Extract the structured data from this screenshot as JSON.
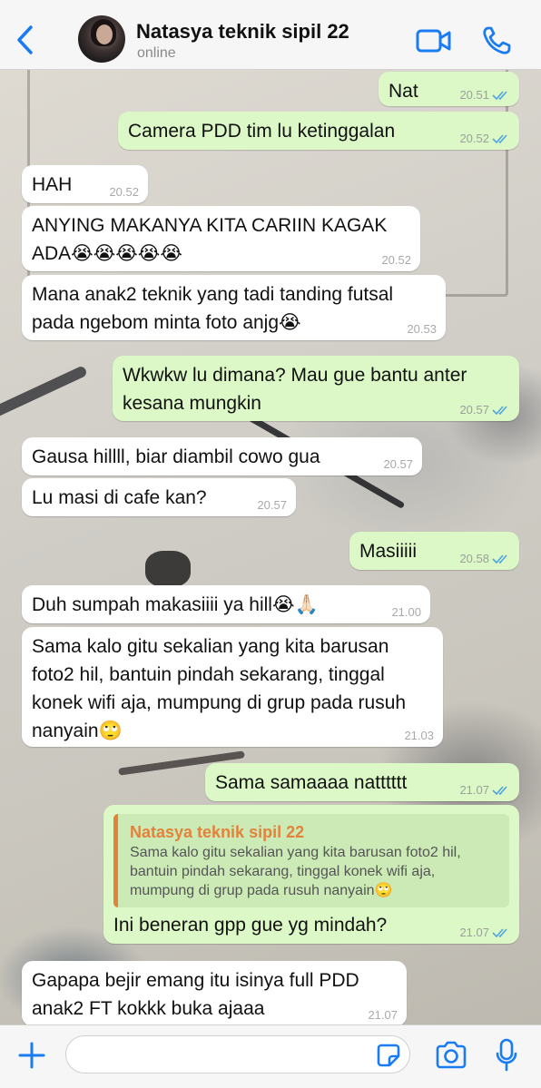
{
  "header": {
    "contact_name": "Natasya teknik sipil 22",
    "status": "online"
  },
  "colors": {
    "accent": "#1a7cf2",
    "outgoing_bubble": "#dcf8c6",
    "incoming_bubble": "#ffffff",
    "read_ticks": "#4fa3e0",
    "quote_name": "#e3823b"
  },
  "icons": {
    "back": "chevron-left-icon",
    "video": "video-camera-icon",
    "call": "phone-icon",
    "plus": "plus-icon",
    "sticker": "sticker-icon",
    "camera": "camera-icon",
    "mic": "microphone-icon",
    "read": "double-check-icon"
  },
  "messages": [
    {
      "dir": "out",
      "text": "Nat",
      "time": "20.51"
    },
    {
      "dir": "out",
      "text": "Camera PDD tim lu ketinggalan",
      "time": "20.52"
    },
    {
      "dir": "in",
      "text": "HAH",
      "time": "20.52"
    },
    {
      "dir": "in",
      "text": "ANYING MAKANYA KITA CARIIN KAGAK ADA😭😭😭😭😭",
      "time": "20.52"
    },
    {
      "dir": "in",
      "text": "Mana anak2 teknik yang tadi tanding futsal pada ngebom minta foto anjg😭",
      "time": "20.53"
    },
    {
      "dir": "out",
      "text": "Wkwkw lu dimana? Mau gue bantu anter kesana mungkin",
      "time": "20.57"
    },
    {
      "dir": "in",
      "text": "Gausa hillll, biar diambil cowo gua",
      "time": "20.57"
    },
    {
      "dir": "in",
      "text": "Lu masi di cafe kan?",
      "time": "20.57"
    },
    {
      "dir": "out",
      "text": "Masiiiii",
      "time": "20.58"
    },
    {
      "dir": "in",
      "text": "Duh sumpah makasiiii ya hill😭🙏🏻",
      "time": "21.00"
    },
    {
      "dir": "in",
      "text": "Sama kalo gitu sekalian yang kita barusan foto2 hil, bantuin pindah sekarang, tinggal konek wifi aja, mumpung di grup pada rusuh nanyain🙄",
      "time": "21.03"
    },
    {
      "dir": "out",
      "text": "Sama samaaaa natttttt",
      "time": "21.07"
    },
    {
      "dir": "out",
      "text": "Ini beneran gpp gue yg mindah?",
      "time": "21.07",
      "quote": {
        "name": "Natasya teknik sipil 22",
        "text": "Sama kalo gitu sekalian yang kita barusan foto2 hil, bantuin pindah sekarang, tinggal konek wifi aja, mumpung di grup pada rusuh nanyain🙄"
      }
    },
    {
      "dir": "in",
      "text": "Gapapa bejir emang itu isinya full PDD anak2 FT kokkk buka ajaaa",
      "time": "21.07"
    }
  ],
  "input": {
    "value": "",
    "placeholder": ""
  }
}
